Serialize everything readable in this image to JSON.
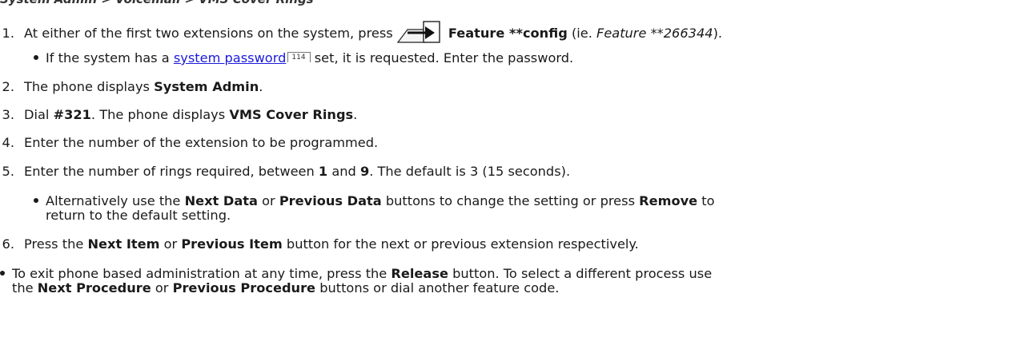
{
  "heading": "System Admin > Voicemail > VMS Cover Rings",
  "steps": [
    {
      "num": "1.",
      "a": "At either of the first two extensions on the system, press",
      "b": "Feature **config",
      "c": "(ie.",
      "d": "Feature **266344",
      "e": ")."
    },
    {
      "num": "2.",
      "a": "The phone displays",
      "b": "System Admin",
      "c": "."
    },
    {
      "num": "3.",
      "a": "Dial",
      "b": "#321",
      "c": ". The phone displays",
      "d": "VMS Cover Rings",
      "e": "."
    },
    {
      "num": "4.",
      "a": "Enter the number of the extension to be programmed."
    },
    {
      "num": "5.",
      "a": "Enter the number of rings required, between",
      "b": "1",
      "c": "and",
      "d": "9",
      "e": ". The default is 3 (15 seconds)."
    },
    {
      "num": "6.",
      "a": "Press the",
      "b": "Next Item",
      "c": "or",
      "d": "Previous Item",
      "e": "button for the next or previous extension respectively."
    }
  ],
  "sub1": {
    "a": "If the system has a",
    "link": "system password",
    "ref": "114",
    "b": "set, it is requested. Enter the password."
  },
  "sub5": {
    "a": "Alternatively use the",
    "b": "Next Data",
    "c": "or",
    "d": "Previous Data",
    "e": "buttons to change the setting or press",
    "f": "Remove",
    "g": "to",
    "h": "return to the default setting."
  },
  "final": {
    "a": "To exit phone based administration at any time, press the",
    "b": "Release",
    "c": "button. To select a different process use",
    "d": "the",
    "e": "Next Procedure",
    "f": "or",
    "g": "Previous Procedure",
    "h": "buttons or dial another feature code."
  },
  "icons": {
    "feature": "feature-key-icon"
  }
}
